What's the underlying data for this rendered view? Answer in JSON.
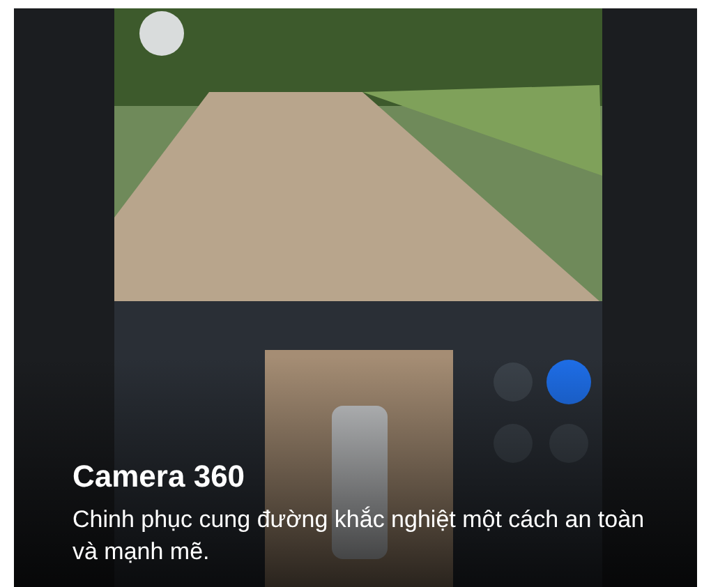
{
  "card": {
    "title": "Camera 360",
    "description": "Chinh phục cung đường khắc nghiệt một cách an toàn và mạnh mẽ."
  }
}
